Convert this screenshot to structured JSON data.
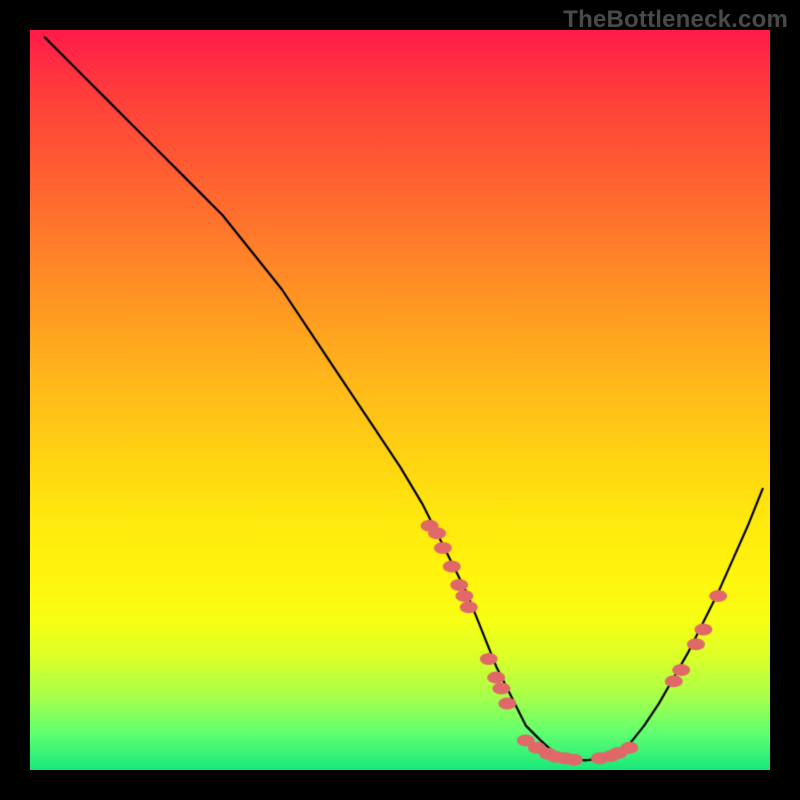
{
  "watermark": "TheBottleneck.com",
  "chart_data": {
    "type": "line",
    "title": "",
    "xlabel": "",
    "ylabel": "",
    "xlim": [
      0,
      100
    ],
    "ylim": [
      0,
      100
    ],
    "background_gradient": "green-to-red vertical",
    "series": [
      {
        "name": "curve",
        "color": "#000000",
        "x": [
          2,
          6,
          10,
          14,
          18,
          22,
          26,
          30,
          34,
          38,
          42,
          46,
          50,
          53,
          56,
          59,
          61,
          63,
          65,
          67,
          69,
          71,
          73,
          75,
          77,
          79,
          81,
          83,
          85,
          87,
          89,
          91,
          93,
          95,
          97,
          99
        ],
        "y": [
          99,
          95,
          91,
          87,
          83,
          79,
          75,
          70,
          65,
          59,
          53,
          47,
          41,
          36,
          30,
          24,
          19,
          14,
          10,
          6,
          4,
          2.2,
          1.6,
          1.3,
          1.5,
          2,
          3.5,
          6,
          9,
          12.5,
          16,
          20,
          24,
          28.5,
          33,
          38
        ]
      },
      {
        "name": "markers-left-cluster",
        "color": "#e06868",
        "marker": "circle",
        "x": [
          54,
          55,
          55.8,
          57,
          58,
          58.7,
          59.3,
          62,
          63,
          63.7,
          64.5
        ],
        "y": [
          33,
          32,
          30,
          27.5,
          25,
          23.5,
          22,
          15,
          12.5,
          11,
          9
        ]
      },
      {
        "name": "markers-bottom-cluster",
        "color": "#e06868",
        "marker": "circle",
        "x": [
          67,
          68.5,
          70,
          71,
          72.3,
          73.5,
          77,
          78.5,
          79.5,
          81
        ],
        "y": [
          4,
          3,
          2.2,
          1.8,
          1.6,
          1.4,
          1.6,
          1.9,
          2.3,
          3
        ]
      },
      {
        "name": "markers-right-cluster",
        "color": "#e06868",
        "marker": "circle",
        "x": [
          87,
          88,
          90,
          91,
          93
        ],
        "y": [
          12,
          13.5,
          17,
          19,
          23.5
        ]
      }
    ]
  }
}
